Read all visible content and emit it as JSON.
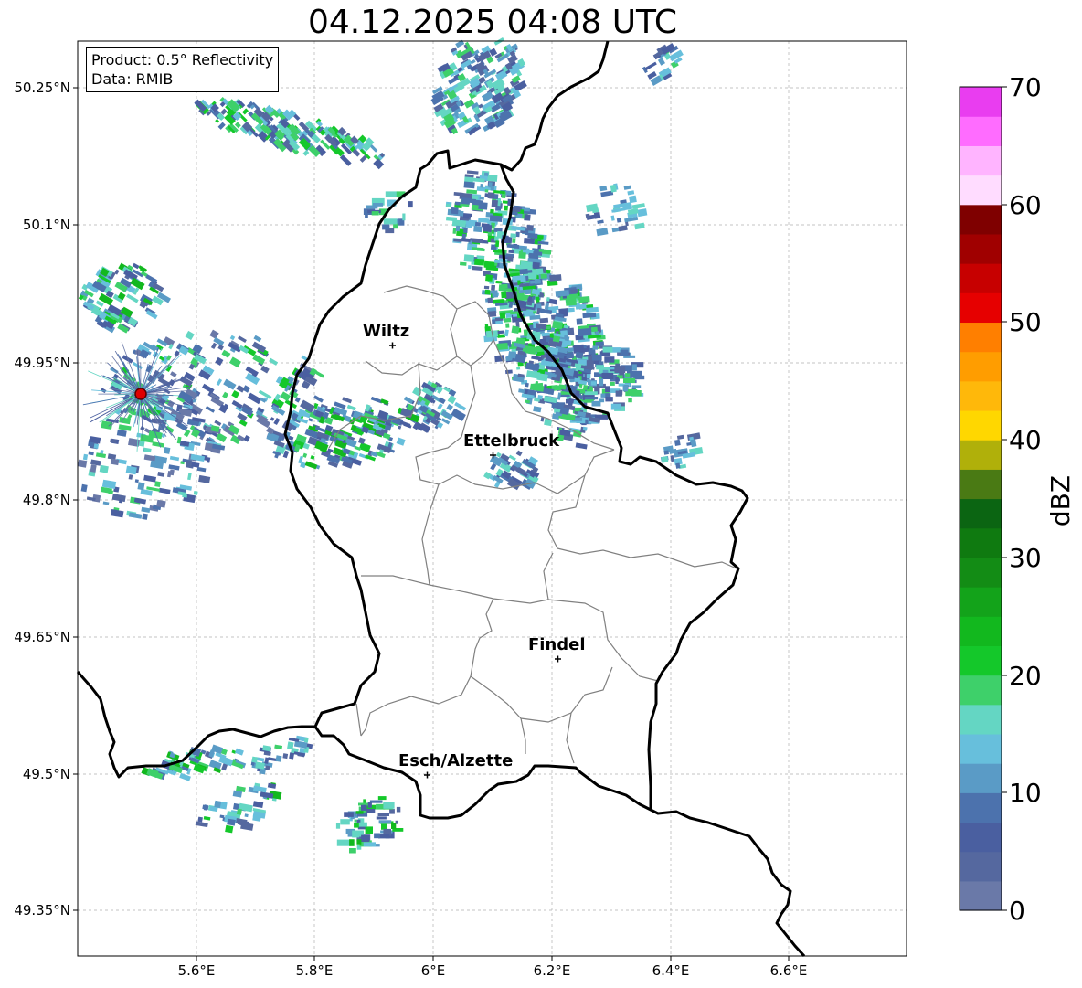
{
  "title": "04.12.2025 04:08 UTC",
  "info": {
    "product": "Product: 0.5° Reflectivity",
    "data": "Data: RMIB"
  },
  "axes": {
    "lat_ticks": [
      "50.25°N",
      "50.1°N",
      "49.95°N",
      "49.8°N",
      "49.65°N",
      "49.5°N",
      "49.35°N"
    ],
    "lon_ticks": [
      "5.6°E",
      "5.8°E",
      "6°E",
      "6.2°E",
      "6.4°E",
      "6.6°E"
    ]
  },
  "cities": [
    {
      "name": "Wiltz"
    },
    {
      "name": "Ettelbruck"
    },
    {
      "name": "Findel"
    },
    {
      "name": "Esch/Alzette"
    }
  ],
  "colorbar": {
    "label": "dBZ",
    "ticks": [
      "0",
      "10",
      "20",
      "30",
      "40",
      "50",
      "60",
      "70"
    ],
    "colors": [
      "#6a79a8",
      "#55689f",
      "#4a5fa0",
      "#4c72ad",
      "#5a9bc6",
      "#67bfdc",
      "#64d6c3",
      "#3ed06a",
      "#14c82a",
      "#12b81e",
      "#13a31a",
      "#138c15",
      "#0f7a10",
      "#0b6512",
      "#4a7a14",
      "#b0b00a",
      "#ffd700",
      "#ffb80a",
      "#ff9d00",
      "#ff7f00",
      "#e60000",
      "#c70000",
      "#a00000",
      "#7f0000",
      "#ffdcff",
      "#ffb4ff",
      "#ff6cff",
      "#e93df0"
    ]
  },
  "colors": {
    "border": "#000000",
    "districts": "#808080",
    "radar_marker": "#e00000"
  }
}
